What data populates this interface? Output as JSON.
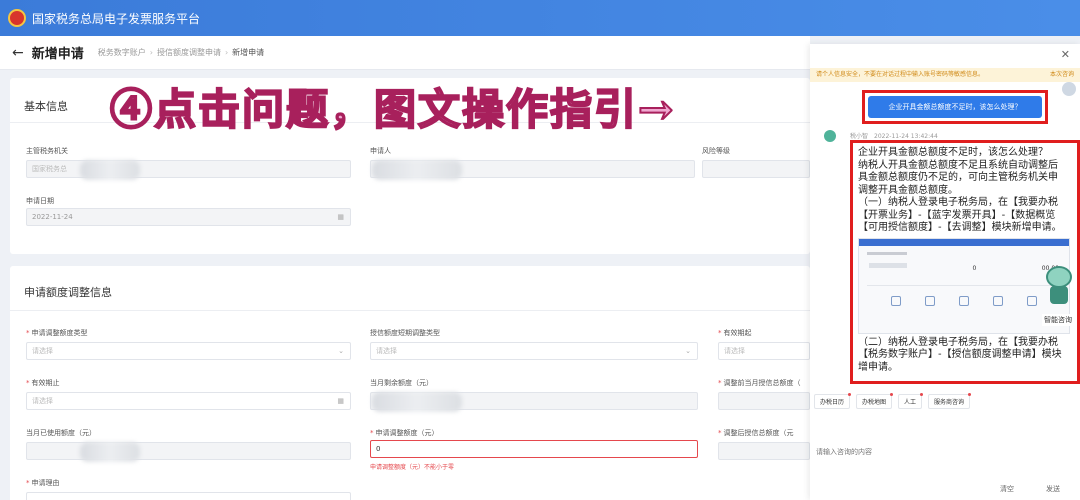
{
  "app": {
    "title": "国家税务总局电子发票服务平台"
  },
  "header": {
    "page_title": "新增申请",
    "breadcrumb": [
      "税务数字账户",
      "授信额度调整申请",
      "新增申请"
    ]
  },
  "basic_info": {
    "section_title": "基本信息",
    "fields": [
      {
        "label": "主管税务机关",
        "value": "国家税务总"
      },
      {
        "label": "申请人",
        "value": ""
      },
      {
        "label": "风险等级",
        "value": ""
      },
      {
        "label": "申请日期",
        "value": "2022-11-24"
      }
    ]
  },
  "adjust_info": {
    "section_title": "申请额度调整信息",
    "fields": [
      {
        "label": "申请调整额度类型",
        "required": true,
        "placeholder": "请选择"
      },
      {
        "label": "授信额度短期调整类型",
        "required": false,
        "placeholder": "请选择"
      },
      {
        "label": "有效期起",
        "required": true,
        "placeholder": "请选择"
      },
      {
        "label": "有效期止",
        "required": true,
        "placeholder": "请选择"
      },
      {
        "label": "当月剩余额度（元）",
        "required": false,
        "value": ""
      },
      {
        "label": "调整前当月授信总额度（",
        "required": true,
        "value": ""
      },
      {
        "label": "当月已使用额度（元）",
        "required": false,
        "value": ""
      },
      {
        "label": "申请调整额度（元）",
        "required": true,
        "value": "0"
      },
      {
        "label": "调整后授信总额度（元",
        "required": true,
        "value": ""
      },
      {
        "label": "申请理由",
        "required": true,
        "placeholder": ""
      }
    ],
    "error_message": "申请调整额度（元）不能小于零"
  },
  "annotation": {
    "text": "④点击问题，图文操作指引→"
  },
  "chat": {
    "notice": "请个人信息安全，不要在对话过程中输入账号密码等敏感信息。",
    "notice_link": "本次咨询",
    "user_time": "2022-11-24 13:42:44",
    "question": "企业开具金额总额度不足时，该怎么处理？",
    "bot_name": "税小智",
    "bot_time": "2022-11-24 13:42:44",
    "answer_lines": [
      "企业开具金额总额度不足时，该怎么处理？",
      "纳税人开具金额总额度不足且系统自动调整后",
      "具金额总额度仍不足的，可向主管税务机关申",
      "调整开具金额总额度。",
      "（一）纳税人登录电子税务局，在【我要办税",
      "【开票业务】-【蓝字发票开具】-【数据概览",
      "【可用授信额度】-【去调整】模块新增申请。"
    ],
    "answer_lines_2": [
      "（二）纳税人登录电子税务局，在【我要办税",
      "【税务数字账户】-【授信额度调整申请】模块",
      "增申请。"
    ],
    "robot_label": "智能咨询",
    "quick_links": [
      "办税日历",
      "办税地图",
      "人工",
      "服务商咨询"
    ],
    "input_placeholder": "请输入咨询的内容",
    "clear_label": "清空",
    "send_label": "发送",
    "close_icon": "close-icon",
    "screenshot_values": [
      "0",
      "00.00"
    ]
  }
}
